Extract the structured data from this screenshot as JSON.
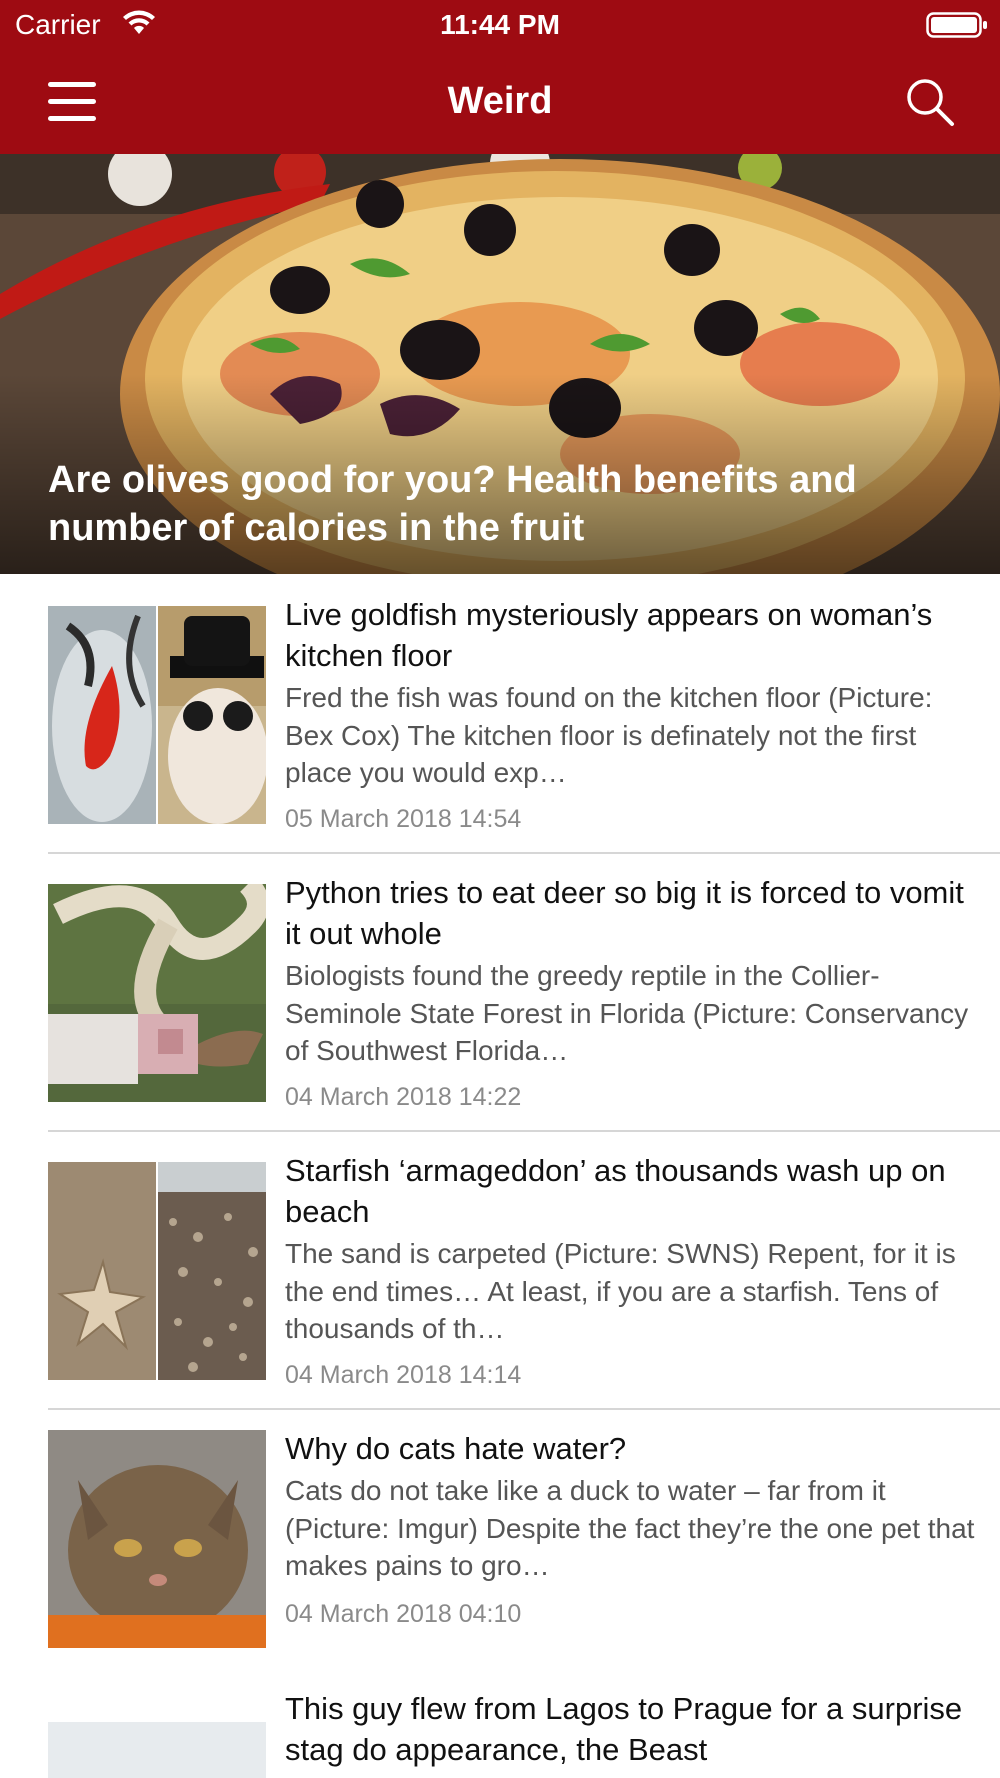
{
  "status_bar": {
    "carrier": "Carrier",
    "time": "11:44 PM"
  },
  "nav": {
    "title": "Weird",
    "menu_icon": "hamburger-menu-icon",
    "search_icon": "search-icon"
  },
  "colors": {
    "brand": "#9e0b12",
    "summary_text": "#555555",
    "date_text": "#8a8a8a",
    "divider": "#d6d6d6"
  },
  "hero": {
    "title": "Are olives good for you? Health benefits and number of calories in the fruit"
  },
  "articles": [
    {
      "headline": "Live goldfish mysteriously appears on woman’s kitchen floor",
      "summary": "Fred the fish was found on the kitchen floor (Picture: Bex Cox)   The kitchen floor is definately not the first place you would exp…",
      "date": "05 March 2018 14:54"
    },
    {
      "headline": "Python tries to eat deer so big it is forced to vomit it out whole",
      "summary": "Biologists found the greedy reptile in the Collier-Seminole State Forest in Florida (Picture: Conservancy of Southwest Florida…",
      "date": "04 March 2018 14:22"
    },
    {
      "headline": "Starfish ‘armageddon’ as thousands wash up on beach",
      "summary": "The sand is carpeted (Picture: SWNS)   Repent, for it is the end times… At least, if you are a starfish.   Tens of thousands of th…",
      "date": "04 March 2018 14:14"
    },
    {
      "headline": "Why do cats hate water?",
      "summary": "Cats do not take like a duck to water – far from it (Picture: Imgur)   Despite the fact they’re the one pet that makes pains to gro…",
      "date": "04 March 2018 04:10"
    },
    {
      "headline": "This guy flew from Lagos to Prague for a surprise stag do appearance, the Beast",
      "summary": "",
      "date": ""
    }
  ]
}
